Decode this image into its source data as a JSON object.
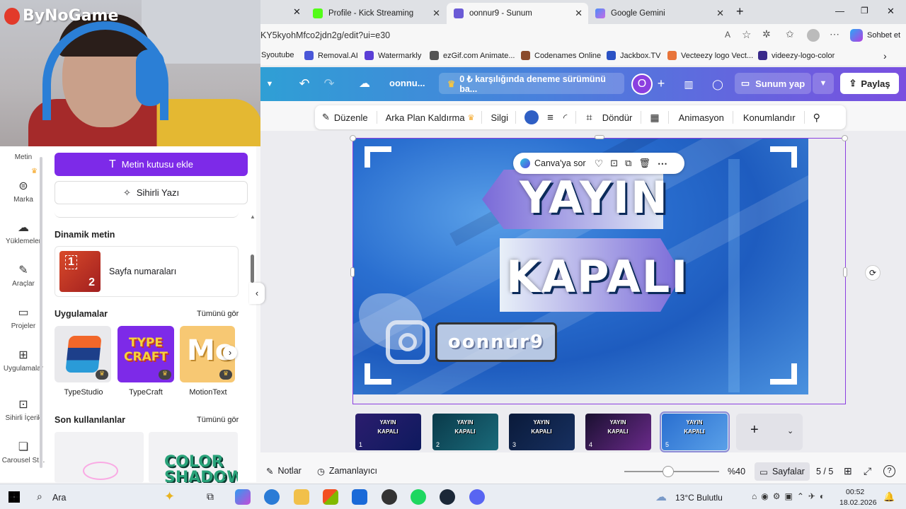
{
  "browser": {
    "tabs": [
      {
        "title": "Profile - Kick Streaming"
      },
      {
        "title": "oonnur9 - Sunum"
      },
      {
        "title": "Google Gemini"
      }
    ],
    "url": "KY5kyohMfco2jdn2g/edit?ui=e30",
    "copilot_label": "Sohbet et",
    "bookmarks": [
      "Syoutube",
      "Removal.AI",
      "Watermarkly",
      "ezGif.com Animate...",
      "Codenames Online",
      "Jackbox.TV",
      "Vecteezy logo Vect...",
      "videezy-logo-color"
    ]
  },
  "overlay": {
    "watermark": "ByNoGame"
  },
  "canva_header": {
    "doc_title": "oonnu...",
    "trial_text": "0 ₺ karşılığında deneme sürümünü ba...",
    "avatar_letter": "O",
    "present_label": "Sunum yap",
    "share_label": "Paylaş"
  },
  "toolbar": {
    "edit": "Düzenle",
    "bg_remove": "Arka Plan Kaldırma",
    "eraser": "Silgi",
    "rotate": "Döndür",
    "animate": "Animasyon",
    "position": "Konumlandır",
    "color": "#2f5fc4"
  },
  "slide": {
    "line1": "YAYIN",
    "line2": "KAPALI",
    "handle": "oonnur9",
    "ask_canva": "Canva'ya sor"
  },
  "sidebar": {
    "items": [
      "Metin",
      "Marka",
      "Yüklemeler",
      "Araçlar",
      "Projeler",
      "Uygulamalar",
      "Sihirli İçerik",
      "Carousel St..."
    ]
  },
  "panel": {
    "add_textbox": "Metin kutusu ekle",
    "magic_write": "Sihirli Yazı",
    "dynamic_text": "Dinamik metin",
    "page_numbers": "Sayfa numaraları",
    "apps": "Uygulamalar",
    "see_all": "Tümünü gör",
    "app_list": [
      {
        "name": "TypeStudio"
      },
      {
        "name": "TypeCraft"
      },
      {
        "name": "MotionText"
      }
    ],
    "recent": "Son kullanılanlar",
    "recent_see_all": "Tümünü gör",
    "recent_thumb": "COLOR SHADOW"
  },
  "thumbs": {
    "slides": [
      {
        "n": "1",
        "l1": "YAYIN",
        "l2": "KAPALI"
      },
      {
        "n": "2",
        "l1": "YAYIN",
        "l2": "KAPALI"
      },
      {
        "n": "3",
        "l1": "YAYIN",
        "l2": "KAPALI"
      },
      {
        "n": "4",
        "l1": "YAYIN",
        "l2": "KAPALI"
      },
      {
        "n": "5",
        "l1": "YAYIN",
        "l2": "KAPALI"
      }
    ]
  },
  "footer": {
    "notes": "Notlar",
    "timer": "Zamanlayıcı",
    "zoom": "%40",
    "zoom_level": 0.4,
    "pages": "Sayfalar",
    "page_count": "5 / 5"
  },
  "taskbar": {
    "search": "Ara",
    "weather": "13°C  Bulutlu",
    "time": "00:52",
    "date": "18.02.2026"
  }
}
